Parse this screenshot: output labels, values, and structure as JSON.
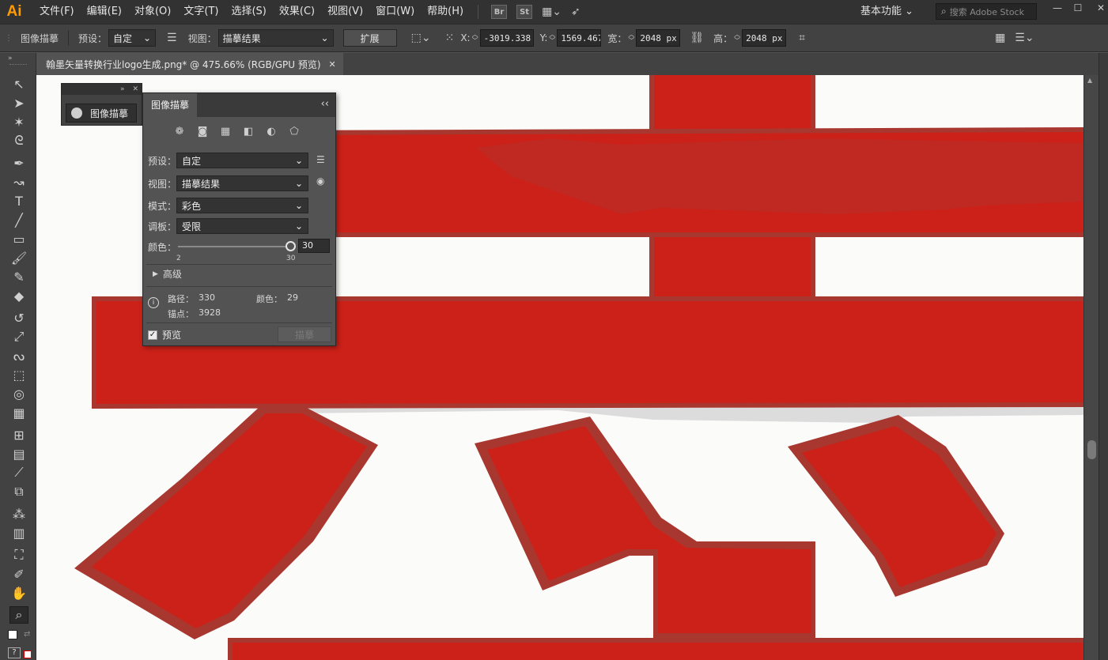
{
  "app": {
    "logo": "Ai"
  },
  "menu": [
    "文件(F)",
    "编辑(E)",
    "对象(O)",
    "文字(T)",
    "选择(S)",
    "效果(C)",
    "视图(V)",
    "窗口(W)",
    "帮助(H)"
  ],
  "menubar_icons": {
    "bridge": "Br",
    "stock": "St",
    "layout_icon": "workspace-layout-icon",
    "gpu_icon": "rocket-icon"
  },
  "workspace": {
    "label": "基本功能 ⌄"
  },
  "search": {
    "placeholder": "搜索 Adobe Stock"
  },
  "window_controls": {
    "minimize": "—",
    "restore": "☐",
    "close": "✕"
  },
  "control_bar": {
    "panel_name": "图像描摹",
    "preset_label": "预设：",
    "preset_value": "自定",
    "view_label": "视图：",
    "view_value": "描摹结果",
    "expand_button": "扩展",
    "x_label": "X:",
    "x_value": "-3019.338",
    "y_label": "Y:",
    "y_value": "1569.467",
    "w_label": "宽：",
    "w_value": "2048 px",
    "h_label": "高：",
    "h_value": "2048 px"
  },
  "document_tab": {
    "title": "翰墨矢量转换行业logo生成.png* @ 475.66% (RGB/GPU 预览)",
    "close": "✕"
  },
  "collapsed_panel": {
    "label": "图像描摹"
  },
  "trace_panel": {
    "title": "图像描摹",
    "preset": {
      "label": "预设：",
      "value": "自定"
    },
    "view": {
      "label": "视图：",
      "value": "描摹结果"
    },
    "mode": {
      "label": "模式：",
      "value": "彩色"
    },
    "palette": {
      "label": "调板：",
      "value": "受限"
    },
    "colors": {
      "label": "颜色：",
      "value": "30",
      "min": "2",
      "max": "30",
      "fraction": 1.0
    },
    "advanced": "高级",
    "stats": {
      "paths_label": "路径：",
      "paths": "330",
      "colors_label": "颜色：",
      "colors": "29",
      "anchors_label": "锚点：",
      "anchors": "3928"
    },
    "preview_label": "预览",
    "preview_checked": true,
    "trace_button": "描摹"
  },
  "colors": {
    "artwork_red": "#cc2118",
    "artwork_edge": "#a8372f",
    "canvas_bg": "#fbfbfa",
    "ui_dark": "#323232",
    "ui_mid": "#424242",
    "ui_panel": "#535353",
    "logo_orange": "#ff9a00"
  }
}
